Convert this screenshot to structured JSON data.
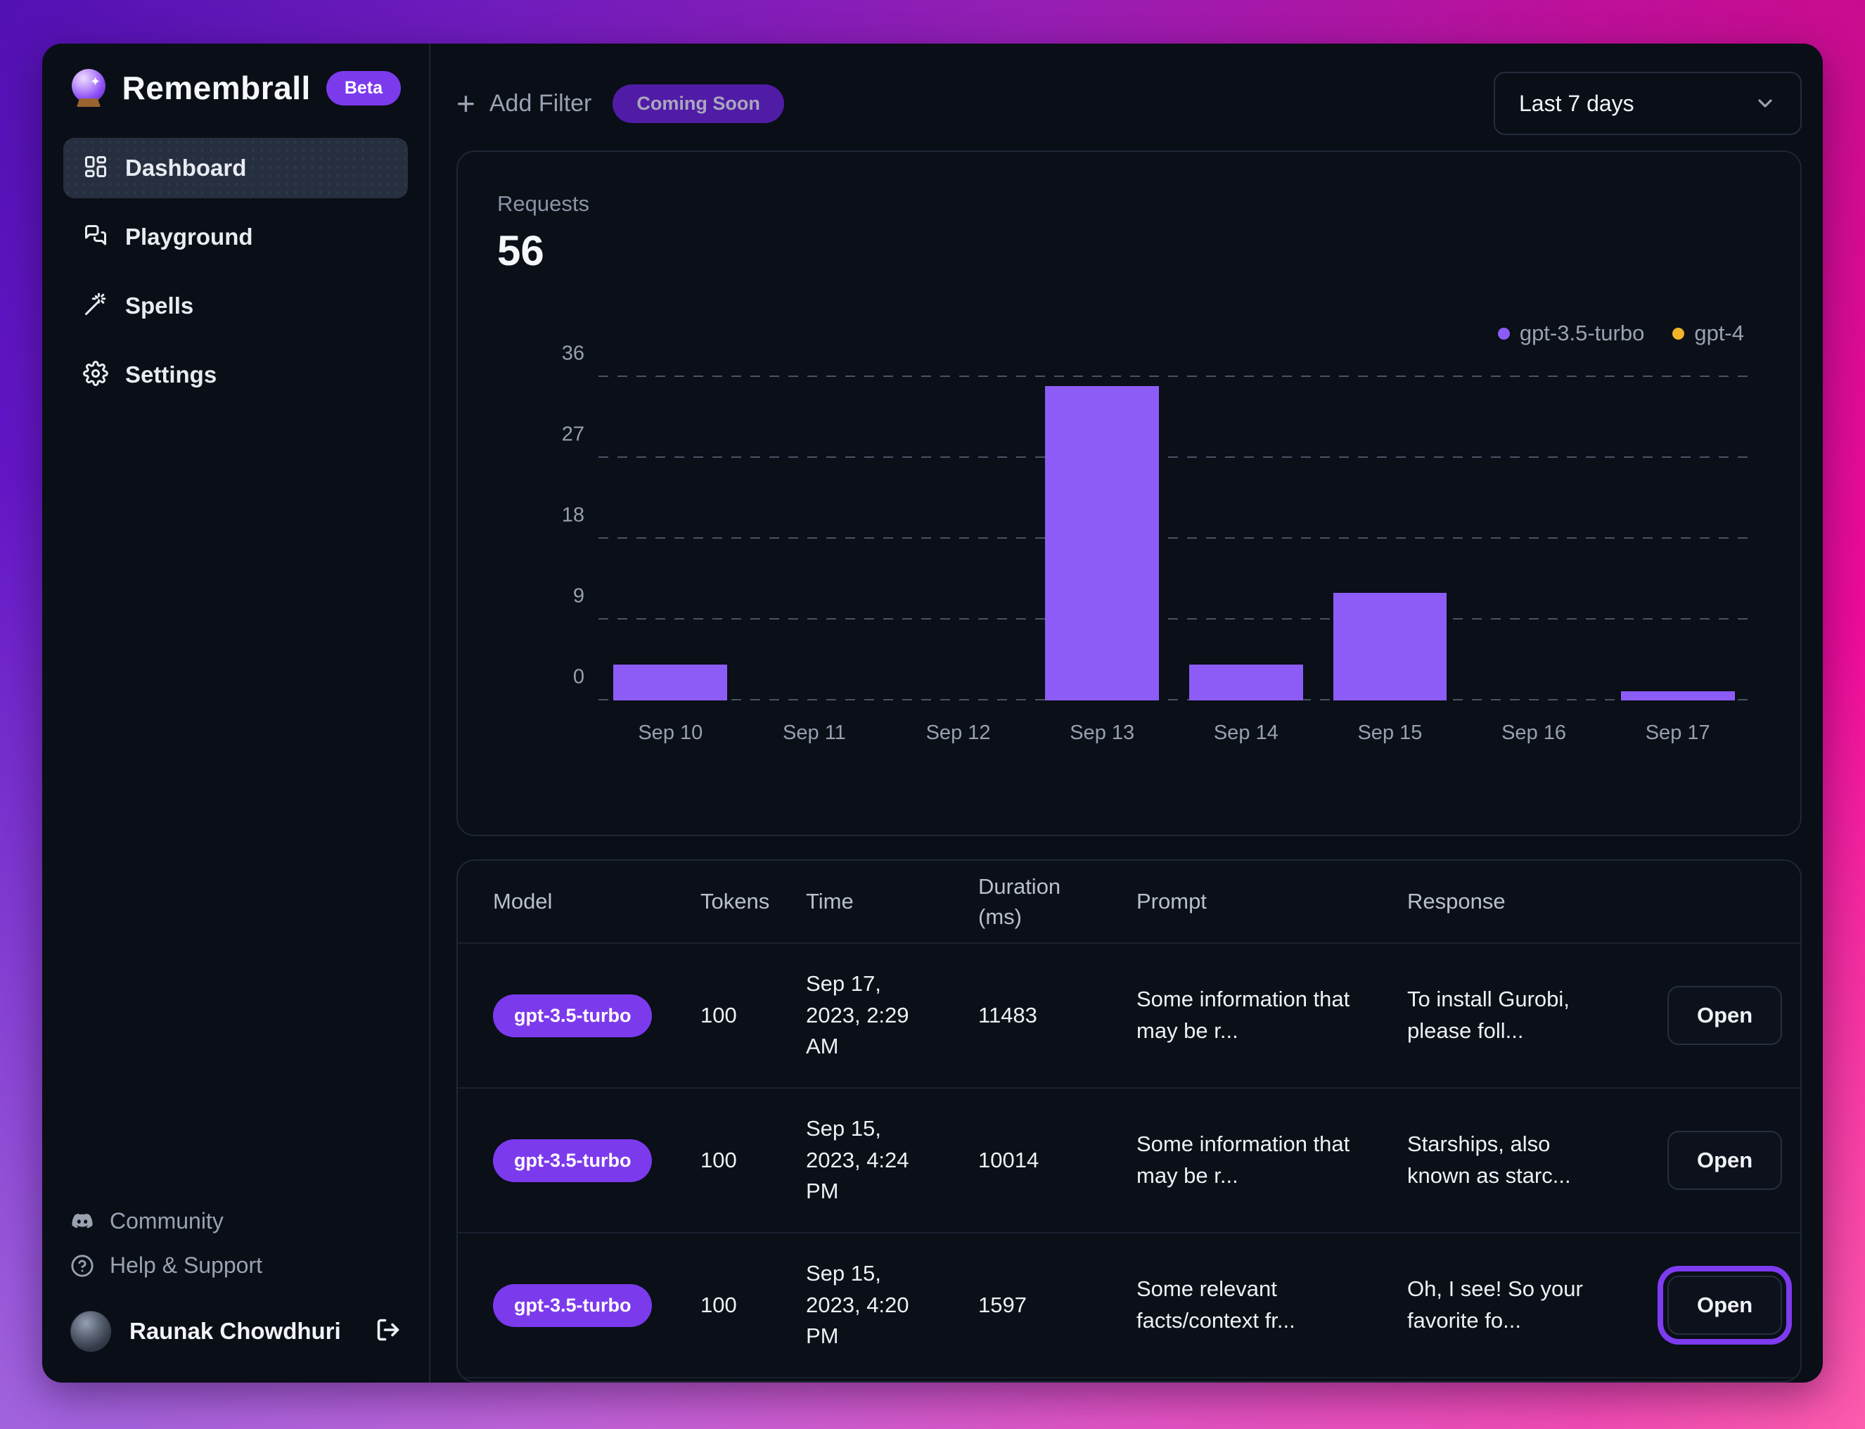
{
  "app": {
    "name": "Remembrall",
    "badge": "Beta"
  },
  "sidebar": {
    "items": [
      {
        "label": "Dashboard",
        "icon": "dashboard-icon",
        "active": true
      },
      {
        "label": "Playground",
        "icon": "playground-chat-icon",
        "active": false
      },
      {
        "label": "Spells",
        "icon": "wand-icon",
        "active": false
      },
      {
        "label": "Settings",
        "icon": "gear-icon",
        "active": false
      }
    ],
    "footer_items": [
      {
        "label": "Community",
        "icon": "discord-icon"
      },
      {
        "label": "Help & Support",
        "icon": "help-circle-icon"
      }
    ],
    "user": {
      "name": "Raunak Chowdhuri"
    }
  },
  "topbar": {
    "add_filter_label": "Add Filter",
    "coming_soon_badge": "Coming Soon",
    "date_range": "Last 7 days"
  },
  "chart_data": {
    "type": "bar",
    "title": "Requests",
    "total": "56",
    "categories": [
      "Sep 10",
      "Sep 11",
      "Sep 12",
      "Sep 13",
      "Sep 14",
      "Sep 15",
      "Sep 16",
      "Sep 17"
    ],
    "series": [
      {
        "name": "gpt-3.5-turbo",
        "color": "#8d5cf6",
        "values": [
          4,
          0,
          0,
          35,
          4,
          12,
          0,
          1
        ]
      },
      {
        "name": "gpt-4",
        "color": "#f0b429",
        "values": [
          0,
          0,
          0,
          0,
          0,
          0,
          0,
          0
        ]
      }
    ],
    "xlabel": "",
    "ylabel": "",
    "ylim": [
      0,
      36
    ],
    "yticks": [
      0,
      9,
      18,
      27,
      36
    ],
    "grid": "horizontal-dashed",
    "legend_position": "top-right"
  },
  "table": {
    "headers": [
      "Model",
      "Tokens",
      "Time",
      "Duration (ms)",
      "Prompt",
      "Response",
      ""
    ],
    "rows": [
      {
        "model": "gpt-3.5-turbo",
        "tokens": "100",
        "time": "Sep 17, 2023, 2:29 AM",
        "duration_ms": "11483",
        "prompt": "Some information that may be r...",
        "response": "To install Gurobi, please foll...",
        "action": "Open",
        "focused": false
      },
      {
        "model": "gpt-3.5-turbo",
        "tokens": "100",
        "time": "Sep 15, 2023, 4:24 PM",
        "duration_ms": "10014",
        "prompt": "Some information that may be r...",
        "response": "Starships, also known as starc...",
        "action": "Open",
        "focused": false
      },
      {
        "model": "gpt-3.5-turbo",
        "tokens": "100",
        "time": "Sep 15, 2023, 4:20 PM",
        "duration_ms": "1597",
        "prompt": "Some relevant facts/context fr...",
        "response": "Oh, I see! So your favorite fo...",
        "action": "Open",
        "focused": true
      }
    ]
  },
  "colors": {
    "accent_purple": "#7c3aed",
    "bar_purple": "#8d5cf6",
    "gpt4_yellow": "#f0b429",
    "window_bg": "#0a0e17"
  }
}
